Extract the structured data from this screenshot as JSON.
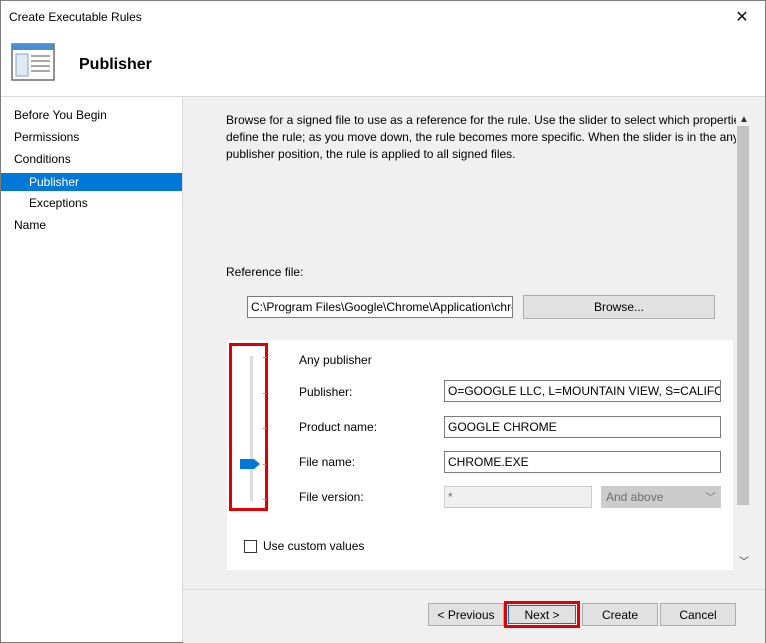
{
  "window": {
    "title": "Create Executable Rules"
  },
  "header": {
    "title": "Publisher",
    "icon": "wizard-page-icon"
  },
  "nav": {
    "items": [
      {
        "label": "Before You Begin",
        "selected": false,
        "indent": false
      },
      {
        "label": "Permissions",
        "selected": false,
        "indent": false
      },
      {
        "label": "Conditions",
        "selected": false,
        "indent": false
      },
      {
        "label": "Publisher",
        "selected": true,
        "indent": true
      },
      {
        "label": "Exceptions",
        "selected": false,
        "indent": true
      },
      {
        "label": "Name",
        "selected": false,
        "indent": false
      }
    ]
  },
  "main": {
    "description_lines": [
      "Browse for a signed file to use as a reference for the rule. Use the slider to select which properties",
      "define the rule; as you move down, the rule becomes more specific. When the slider is in the any",
      "publisher position, the rule is applied to all signed files."
    ],
    "reference_label": "Reference file:",
    "reference_value": "C:\\Program Files\\Google\\Chrome\\Application\\chrome.exe",
    "browse_label": "Browse...",
    "slider": {
      "levels": [
        "Any publisher",
        "Publisher:",
        "Product name:",
        "File name:",
        "File version:"
      ],
      "selected_level": "File name:"
    },
    "fields": {
      "publisher": "O=GOOGLE LLC, L=MOUNTAIN VIEW, S=CALIFORNIA, C=US",
      "product_name": "GOOGLE CHROME",
      "file_name": "CHROME.EXE",
      "file_version": "*",
      "version_mode": "And above"
    },
    "custom_values_label": "Use custom values"
  },
  "footer": {
    "previous": "< Previous",
    "next": "Next >",
    "create": "Create",
    "cancel": "Cancel"
  },
  "colors": {
    "selection": "#0078d7",
    "highlight": "#e00000"
  }
}
